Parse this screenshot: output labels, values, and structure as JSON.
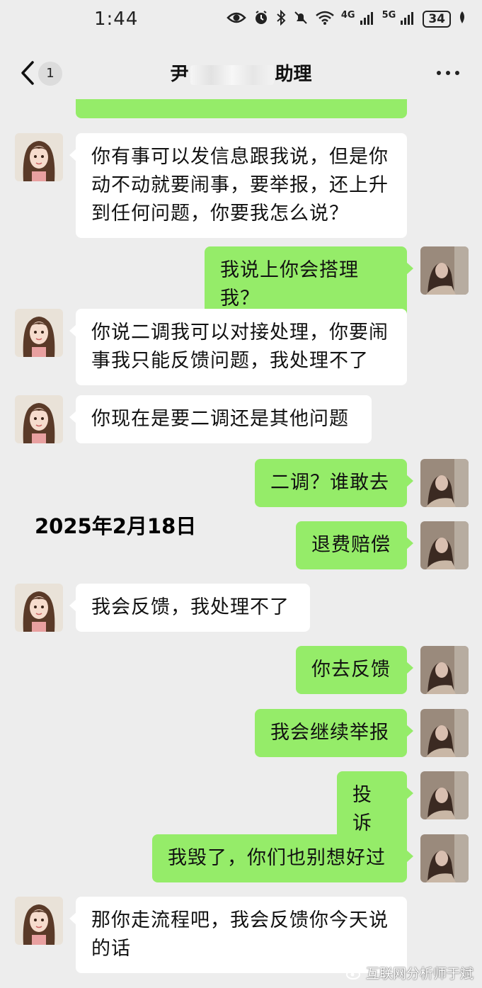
{
  "status_bar": {
    "time": "1:44",
    "network_labels": [
      "4G",
      "5G"
    ],
    "battery": "34",
    "icons": [
      "eye-icon",
      "alarm-icon",
      "bluetooth-icon",
      "mute-icon",
      "wifi-icon",
      "signal-icon",
      "signal-icon",
      "battery-icon",
      "leaf-icon"
    ]
  },
  "header": {
    "unread_count": "1",
    "title_left": "尹",
    "title_right": "助理",
    "back_icon": "chevron-left-icon",
    "more_icon": "more-dots-icon"
  },
  "chat": {
    "date_label": "2025年2月18日",
    "messages": [
      {
        "from": "other",
        "text": "你有事可以发信息跟我说，但是你动不动就要闹事，要举报，还上升到任何问题，你要我怎么说？"
      },
      {
        "from": "me",
        "text": "我说上你会搭理我？"
      },
      {
        "from": "other",
        "text": "你说二调我可以对接处理，你要闹事我只能反馈问题，我处理不了"
      },
      {
        "from": "other",
        "text": "你现在是要二调还是其他问题"
      },
      {
        "from": "me",
        "text": "二调？谁敢去"
      },
      {
        "from": "me",
        "text": "退费赔偿"
      },
      {
        "from": "other",
        "text": "我会反馈，我处理不了"
      },
      {
        "from": "me",
        "text": "你去反馈"
      },
      {
        "from": "me",
        "text": "我会继续举报"
      },
      {
        "from": "me",
        "text": "投诉"
      },
      {
        "from": "me",
        "text": "我毁了，你们也别想好过"
      },
      {
        "from": "other",
        "text": "那你走流程吧，我会反馈你今天说的话"
      }
    ]
  },
  "watermark": "互联网分析师于斌",
  "colors": {
    "background": "#ededed",
    "outgoing_bubble": "#95ec69",
    "incoming_bubble": "#ffffff"
  }
}
